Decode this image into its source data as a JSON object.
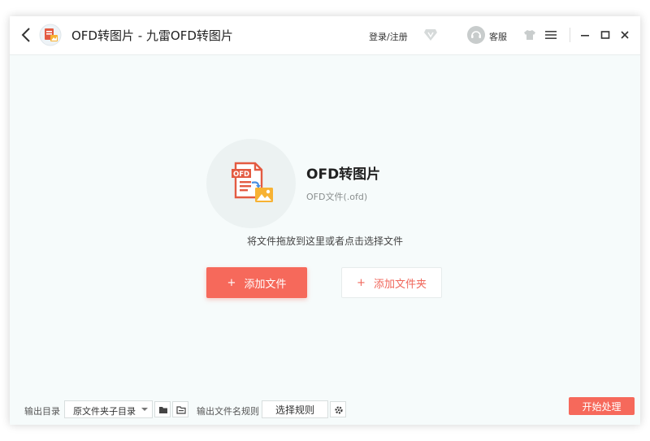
{
  "titlebar": {
    "title": "OFD转图片 - 九雷OFD转图片",
    "login_label": "登录/注册",
    "support_label": "客服"
  },
  "main": {
    "format_name": "OFD转图片",
    "format_ext": "OFD文件(.ofd)",
    "drop_hint": "将文件拖放到这里或者点击选择文件",
    "add_file_label": "添加文件",
    "add_folder_label": "添加文件夹",
    "plus_symbol": "+"
  },
  "footer": {
    "output_dir_label": "输出目录",
    "output_dir_value": "原文件夹子目录",
    "filename_rule_label": "输出文件名规则",
    "rule_button_label": "选择规则",
    "start_label": "开始处理"
  },
  "colors": {
    "accent": "#f6695b",
    "background": "#f6fbfb"
  },
  "icons": [
    "back-icon",
    "app-logo-icon",
    "vip-diamond-icon",
    "support-avatar-icon",
    "skin-shirt-icon",
    "menu-icon",
    "minimize-icon",
    "maximize-icon",
    "close-icon",
    "ofd-to-image-icon",
    "folder-icon",
    "open-folder-icon",
    "gear-icon"
  ]
}
